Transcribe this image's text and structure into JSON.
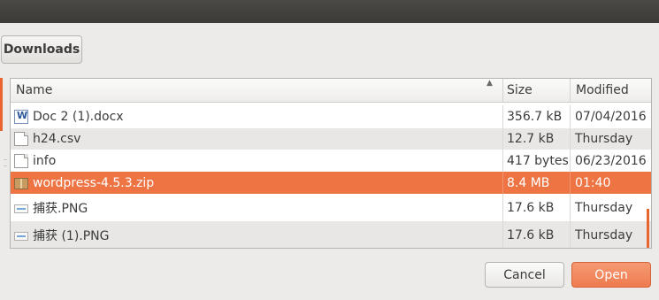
{
  "window": {
    "path_button": "Downloads"
  },
  "file_list": {
    "columns": {
      "name": "Name",
      "size": "Size",
      "modified": "Modified"
    },
    "sort": "ascending",
    "rows": [
      {
        "name": "Doc 2 (1).docx",
        "size": "356.7 kB",
        "modified": "07/04/2016",
        "icon": "word-document-icon",
        "selected": false
      },
      {
        "name": "h24.csv",
        "size": "12.7 kB",
        "modified": "Thursday",
        "icon": "text-file-icon",
        "selected": false
      },
      {
        "name": "info",
        "size": "417 bytes",
        "modified": "06/23/2016",
        "icon": "text-file-icon",
        "selected": false
      },
      {
        "name": "wordpress-4.5.3.zip",
        "size": "8.4 MB",
        "modified": "01:40",
        "icon": "archive-icon",
        "selected": true
      },
      {
        "name": "捕获.PNG",
        "size": "17.6 kB",
        "modified": "Thursday",
        "icon": "image-file-icon",
        "selected": false
      },
      {
        "name": "捕获 (1).PNG",
        "size": "17.6 kB",
        "modified": "Thursday",
        "icon": "image-file-icon",
        "selected": false
      }
    ]
  },
  "actions": {
    "cancel": "Cancel",
    "open": "Open"
  },
  "colors": {
    "accent": "#ef7444",
    "titlebar": "#3c3b37",
    "background": "#ecebe9"
  }
}
